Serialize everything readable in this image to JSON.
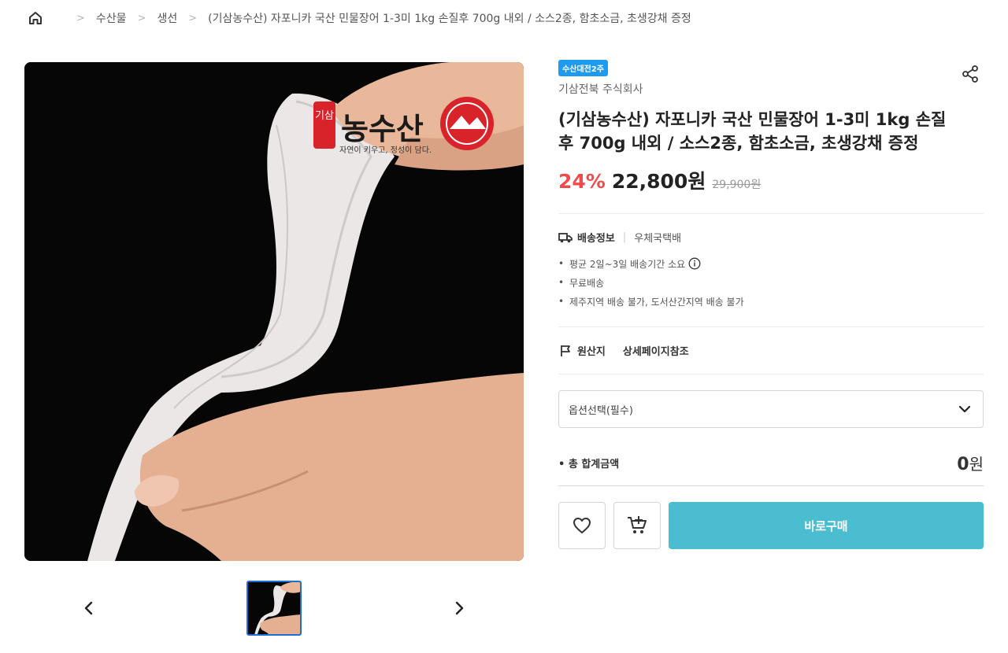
{
  "breadcrumb": {
    "items": [
      "수산물",
      "생선",
      "(기삼농수산) 자포니카 국산 민물장어 1-3미 1kg 손질후 700g 내외 / 소스2종, 함초소금, 초생강채 증정"
    ]
  },
  "gallery": {
    "watermark_logo": "농수산",
    "watermark_prefix": "기삼",
    "watermark_tagline": "자연이 키우고, 정성이 담다."
  },
  "product": {
    "badge": "수산대전2주",
    "seller": "기삼전북 주식회사",
    "title": "(기삼농수산) 자포니카 국산 민물장어 1-3미 1kg 손질후 700g 내외 / 소스2종, 함초소금, 초생강채 증정",
    "discount": "24%",
    "price": "22,800원",
    "original_price": "29,900원"
  },
  "shipping": {
    "label": "배송정보",
    "method": "우체국택배",
    "bullets": [
      "평균 2일~3일 배송기간 소요",
      "무료배송",
      "제주지역 배송 불가, 도서산간지역 배송 불가"
    ]
  },
  "origin": {
    "label": "원산지",
    "value": "상세페이지참조"
  },
  "option": {
    "placeholder": "옵션선택(필수)"
  },
  "total": {
    "label": "총 합계금액",
    "amount": "0",
    "unit": "원"
  },
  "actions": {
    "buy_label": "바로구매"
  },
  "colors": {
    "accent_buy": "#4bbdd0",
    "discount": "#f04b4b",
    "badge": "#1e9bf0"
  }
}
